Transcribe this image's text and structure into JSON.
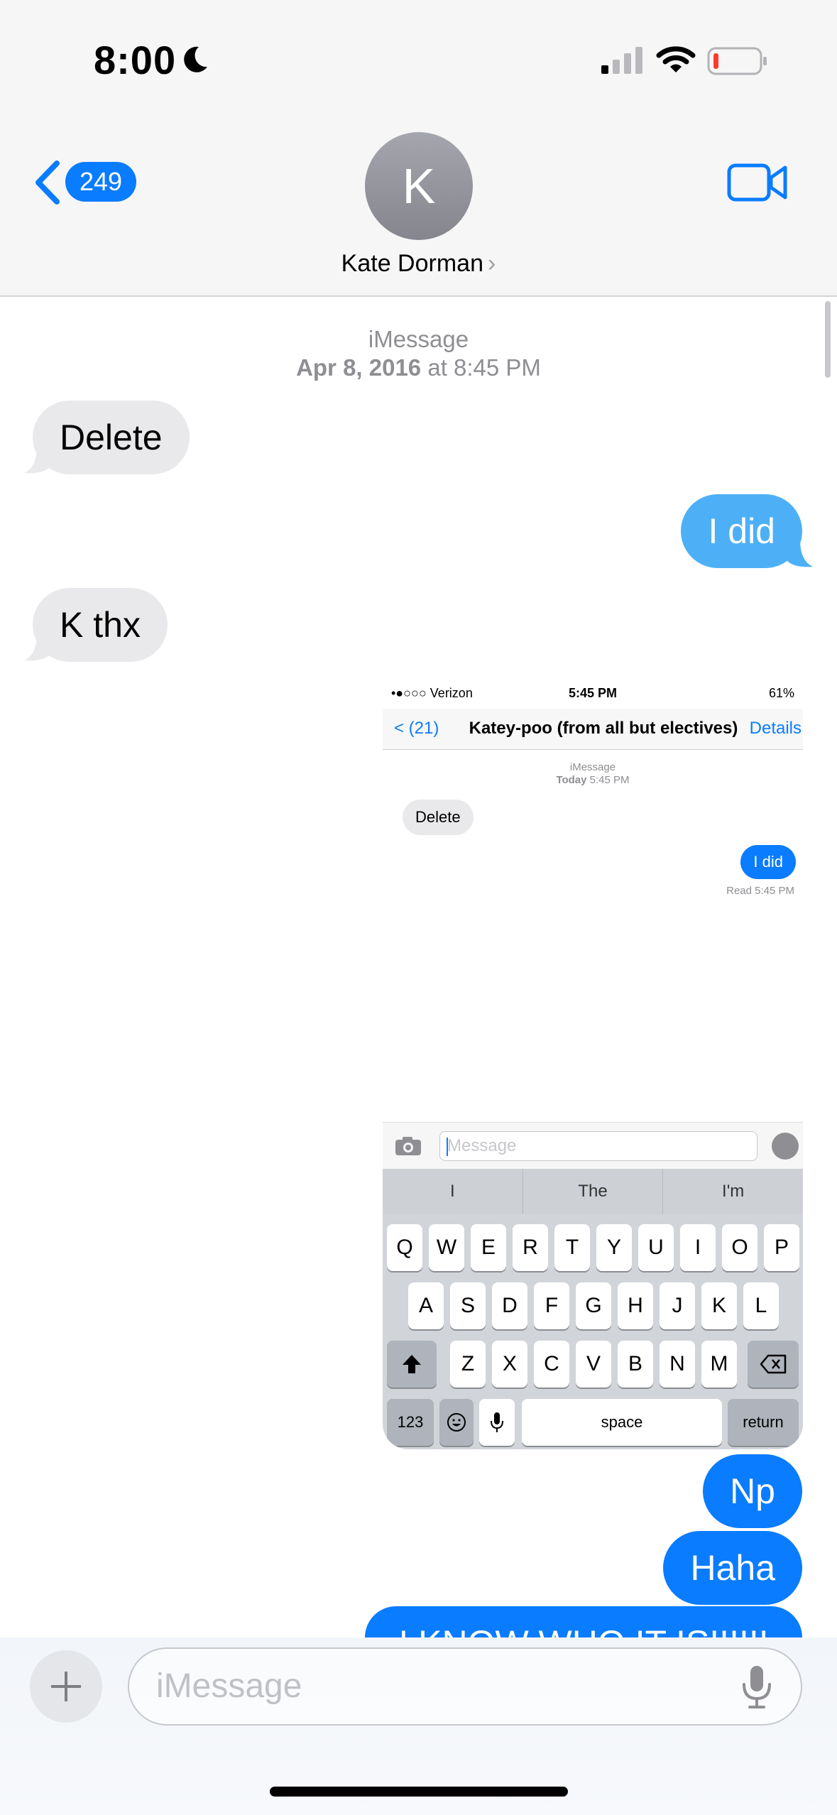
{
  "status_bar": {
    "time": "8:00"
  },
  "nav": {
    "back_count": "249",
    "avatar_initial": "K",
    "contact_name": "Kate Dorman",
    "contact_chevron": "›"
  },
  "thread": {
    "timestamp_service": "iMessage",
    "timestamp_date": "Apr 8, 2016",
    "timestamp_time": " at 8:45 PM",
    "messages": [
      {
        "direction": "received",
        "text": "Delete"
      },
      {
        "direction": "sent",
        "text": "I did"
      },
      {
        "direction": "received",
        "text": "K thx"
      },
      {
        "direction": "sent",
        "type": "image"
      },
      {
        "direction": "sent",
        "text": "Np"
      },
      {
        "direction": "sent",
        "text": "Haha"
      },
      {
        "direction": "sent",
        "text": "I KNOW WHO IT IS!!!!!!"
      }
    ]
  },
  "screenshot": {
    "carrier": "•●○○○ Verizon",
    "time": "5:45 PM",
    "battery": "61%",
    "back": "< (21)",
    "title": "Katey-poo (from all but electives)",
    "details": "Details",
    "ts_service": "iMessage",
    "ts_day": "Today",
    "ts_time": "5:45 PM",
    "msg1": "Delete",
    "msg2": "I did",
    "read": "Read 5:45 PM",
    "input_placeholder": "Message",
    "predictions": [
      "I",
      "The",
      "I'm"
    ],
    "row1": [
      "Q",
      "W",
      "E",
      "R",
      "T",
      "Y",
      "U",
      "I",
      "O",
      "P"
    ],
    "row2": [
      "A",
      "S",
      "D",
      "F",
      "G",
      "H",
      "J",
      "K",
      "L"
    ],
    "row3": [
      "Z",
      "X",
      "C",
      "V",
      "B",
      "N",
      "M"
    ],
    "key_123": "123",
    "key_space": "space",
    "key_return": "return"
  },
  "composer": {
    "placeholder": "iMessage"
  },
  "colors": {
    "accent": "#0a7cff",
    "received_bubble": "#e9e9eb",
    "sent_light": "#4db0f7"
  },
  "icons": [
    "moon-icon",
    "signal-icon",
    "wifi-icon",
    "battery-icon",
    "back-chevron-icon",
    "facetime-video-icon",
    "plus-icon",
    "microphone-icon",
    "camera-icon"
  ]
}
